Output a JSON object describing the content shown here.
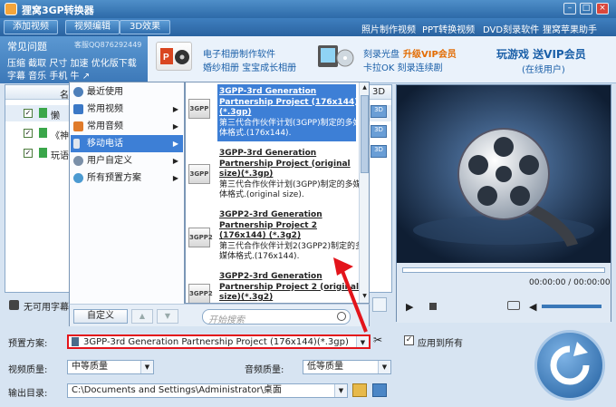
{
  "window": {
    "title": "狸窝3GP转换器"
  },
  "toolbar": {
    "add_video": "添加视频",
    "edit_video": "视频编辑",
    "effect_3d": "3D效果",
    "links": [
      "照片制作视频",
      "PPT转换视频",
      "DVD刻录软件",
      "狸窝苹果助手"
    ]
  },
  "promo": {
    "faq_title": "常见问题",
    "qq": "客服QQ876292449",
    "faq_links_1": "压缩 截取 尺寸 加速 优化版下载",
    "faq_links_2": "字幕 音乐 手机 牛 ↗",
    "ppt_line1": "电子相册制作软件",
    "ppt_line2": "婚纱相册 宝宝成长相册",
    "burn_line1": "刻录光盘",
    "burn_vip": "升级VIP会员",
    "burn_line2": "卡拉OK 刻录连续剧",
    "game_line1": "玩游戏 送VIP会员",
    "game_line2": "(在线用户)"
  },
  "list": {
    "header_name": "名",
    "header_3d": "3D",
    "rows": [
      "懒",
      "《神",
      "玩语"
    ],
    "subtitle": "无可用字幕"
  },
  "menu1": {
    "items": [
      "最近使用",
      "常用视频",
      "常用音频",
      "移动电话",
      "用户自定义",
      "所有预置方案"
    ],
    "custom_button": "自定义",
    "search_placeholder": "开始搜索"
  },
  "menu2": {
    "formats": [
      {
        "icon": "3GPP",
        "title": "3GPP-3rd Generation Partnership Project (176x144) (*.3gp)",
        "desc": "第三代合作伙伴计划(3GPP)制定的多媒体格式.(176x144)."
      },
      {
        "icon": "3GPP",
        "title": "3GPP-3rd Generation Partnership Project (original size)(*.3gp)",
        "desc": "第三代合作伙伴计划(3GPP)制定的多媒体格式.(original size)."
      },
      {
        "icon": "3GPP2",
        "title": "3GPP2-3rd Generation Partnership Project 2 (176x144) (*.3g2)",
        "desc": "第三代合作伙伴计划2(3GPP2)制定的多媒体格式.(176x144)."
      },
      {
        "icon": "3GPP2",
        "title": "3GPP2-3rd Generation Partnership Project 2 (original size)(*.3g2)",
        "desc": ""
      }
    ]
  },
  "settings": {
    "preset_label": "预置方案:",
    "preset_value": "3GPP-3rd Generation Partnership Project (176x144)(*.3gp)",
    "apply_all": "应用到所有",
    "video_quality_label": "视频质量:",
    "video_quality": "中等质量",
    "audio_quality_label": "音频质量:",
    "audio_quality": "低等质量",
    "output_label": "输出目录:",
    "output_path": "C:\\Documents and Settings\\Administrator\\桌面"
  },
  "player": {
    "time": "00:00:00 / 00:00:00"
  },
  "colors": {
    "accent": "#3a78b8",
    "highlight": "#3d7fd6",
    "arrow": "#e3141b"
  }
}
